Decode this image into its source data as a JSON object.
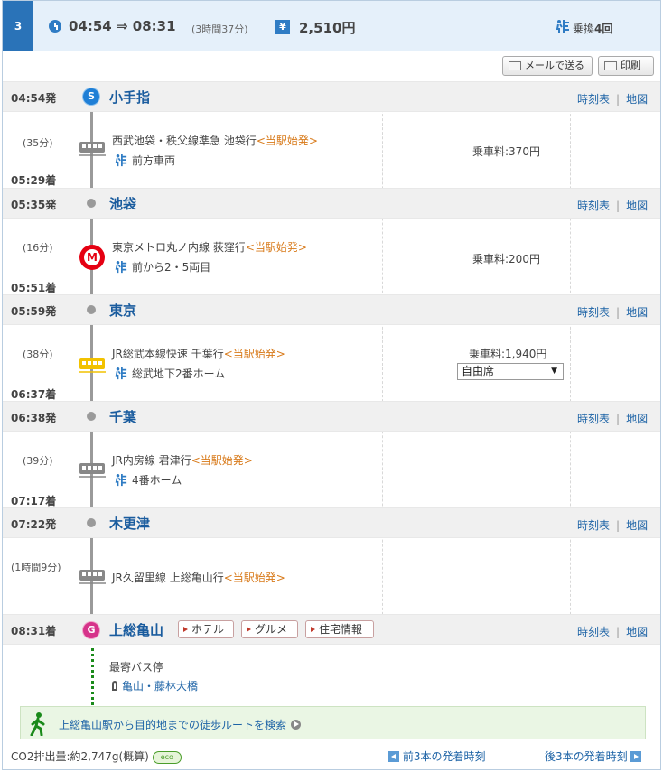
{
  "summary": {
    "route_number": "3",
    "time_range": "04:54 ⇒ 08:31",
    "duration": "(3時間37分)",
    "yen_symbol": "¥",
    "fare_total": "2,510円",
    "transfer_label": "乗換",
    "transfer_count": "4回"
  },
  "toolbar": {
    "mail_label": "メールで送る",
    "print_label": "印刷"
  },
  "links": {
    "timetable": "時刻表",
    "separator": "|",
    "map": "地図"
  },
  "stations": [
    {
      "time": "04:54発",
      "name": "小手指",
      "badge": "S"
    },
    {
      "time": "05:35発",
      "name": "池袋"
    },
    {
      "time": "05:59発",
      "name": "東京"
    },
    {
      "time": "06:38発",
      "name": "千葉"
    },
    {
      "time": "07:22発",
      "name": "木更津"
    },
    {
      "time": "08:31着",
      "name": "上総亀山",
      "badge": "G"
    }
  ],
  "segments": [
    {
      "duration": "(35分)",
      "arrive": "05:29着",
      "line": "西武池袋・秩父線準急 池袋行",
      "origin": "<当駅始発>",
      "sub": "前方車両",
      "fare": "乗車料:370円"
    },
    {
      "duration": "(16分)",
      "arrive": "05:51着",
      "line": "東京メトロ丸ノ内線 荻窪行",
      "origin": "<当駅始発>",
      "sub": "前から2・5両目",
      "fare": "乗車料:200円"
    },
    {
      "duration": "(38分)",
      "arrive": "06:37着",
      "line": "JR総武本線快速 千葉行",
      "origin": "<当駅始発>",
      "sub": "総武地下2番ホーム",
      "fare": "乗車料:1,940円",
      "seat": "自由席"
    },
    {
      "duration": "(39分)",
      "arrive": "07:17着",
      "line": "JR内房線 君津行",
      "origin": "<当駅始発>",
      "sub": "4番ホーム"
    },
    {
      "duration": "(1時間9分)",
      "line": "JR久留里線 上総亀山行",
      "origin": "<当駅始発>"
    }
  ],
  "dest_tags": [
    "ホテル",
    "グルメ",
    "住宅情報"
  ],
  "bus": {
    "label": "最寄バス停",
    "stop": "亀山・藤林大橋"
  },
  "walk": {
    "text": "上総亀山駅から目的地までの徒歩ルートを検索"
  },
  "footer": {
    "co2": "CO2排出量:約2,747g(概算)",
    "eco": "eco",
    "prev": "前3本の発着時刻",
    "next": "後3本の発着時刻"
  },
  "colors": {
    "accent": "#2a73b8",
    "station_name": "#1a5c9e",
    "link": "#1d63a6",
    "origin": "#d87a1a",
    "start_badge": "#1f7fd6",
    "goal_badge": "#d6338a",
    "metro": "#e50012"
  }
}
